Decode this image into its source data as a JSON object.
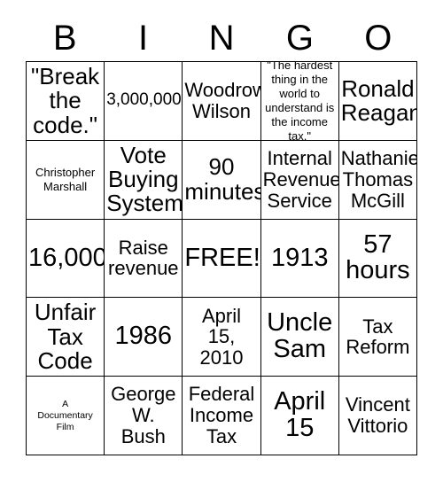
{
  "card": {
    "title": "BINGO",
    "header": [
      "B",
      "I",
      "N",
      "G",
      "O"
    ],
    "free_space_label": "FREE!",
    "rows": [
      [
        {
          "text": "\"Break\nthe\ncode.\"",
          "size": "fs-lg"
        },
        {
          "text": "3,000,000",
          "size": "fs-sm"
        },
        {
          "text": "Woodrow\nWilson",
          "size": "fs-md"
        },
        {
          "text": "\"The hardest\nthing in the\nworld to\nunderstand is\nthe income tax.\"",
          "size": "fs-xs"
        },
        {
          "text": "Ronald\nReagan",
          "size": "fs-lg"
        }
      ],
      [
        {
          "text": "Christopher\nMarshall",
          "size": "fs-xs"
        },
        {
          "text": "Vote\nBuying\nSystem",
          "size": "fs-lg"
        },
        {
          "text": "90\nminutes",
          "size": "fs-lg"
        },
        {
          "text": "Internal\nRevenue\nService",
          "size": "fs-md"
        },
        {
          "text": "Nathaniel\nThomas\nMcGill",
          "size": "fs-md"
        }
      ],
      [
        {
          "text": "16,000",
          "size": "fs-xl"
        },
        {
          "text": "Raise\nrevenue",
          "size": "fs-md"
        },
        {
          "text": "FREE!",
          "size": "fs-xl"
        },
        {
          "text": "1913",
          "size": "fs-xl"
        },
        {
          "text": "57\nhours",
          "size": "fs-xl"
        }
      ],
      [
        {
          "text": "Unfair\nTax\nCode",
          "size": "fs-lg"
        },
        {
          "text": "1986",
          "size": "fs-xl"
        },
        {
          "text": "April\n15,\n2010",
          "size": "fs-md"
        },
        {
          "text": "Uncle\nSam",
          "size": "fs-xl"
        },
        {
          "text": "Tax\nReform",
          "size": "fs-md"
        }
      ],
      [
        {
          "text": "A\nDocumentary\nFilm",
          "size": "fs-xxs"
        },
        {
          "text": "George\nW.\nBush",
          "size": "fs-md"
        },
        {
          "text": "Federal\nIncome\nTax",
          "size": "fs-md"
        },
        {
          "text": "April\n15",
          "size": "fs-xl"
        },
        {
          "text": "Vincent\nVittorio",
          "size": "fs-md"
        }
      ]
    ]
  },
  "colors": {
    "border": "#000000",
    "cell_background": "#ffffff",
    "text": "#000000",
    "page_background": "#ffffff"
  }
}
